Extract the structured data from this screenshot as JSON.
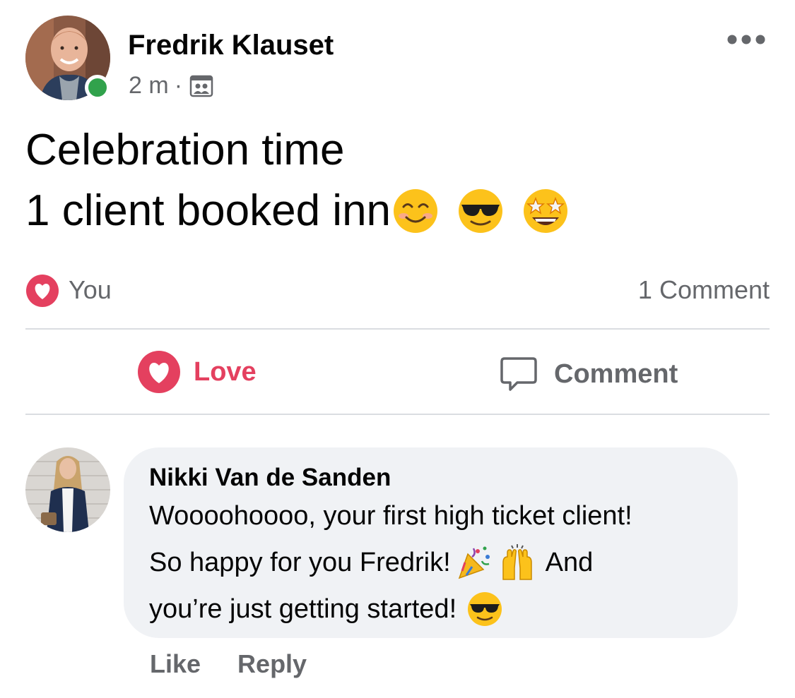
{
  "post": {
    "author": "Fredrik Klauset",
    "time": "2 m",
    "separator": "·",
    "audience_icon": "friends-group-icon",
    "more_icon": "more-options-icon",
    "text_line1": "Celebration time",
    "text_line2": "1 client booked inn",
    "text_emojis": [
      "smiling-face-icon",
      "sunglasses-face-icon",
      "star-struck-face-icon"
    ]
  },
  "reactions": {
    "reactor": "You",
    "icon": "love-reaction-icon",
    "comment_count": "1 Comment"
  },
  "actions": {
    "love_label": "Love",
    "comment_label": "Comment"
  },
  "comment": {
    "author": "Nikki Van de Sanden",
    "line1": "Woooohoooo, your first high ticket client!",
    "line2a": "So happy for you Fredrik!",
    "line2b": "And",
    "line3": "you’re just getting started!",
    "emojis": [
      "party-popper-icon",
      "raising-hands-icon",
      "sunglasses-face-icon"
    ],
    "like_label": "Like",
    "reply_label": "Reply"
  },
  "colors": {
    "love_red": "#e4405f",
    "online_green": "#31a24c",
    "muted_gray": "#65676b",
    "bubble_bg": "#f0f2f5"
  }
}
